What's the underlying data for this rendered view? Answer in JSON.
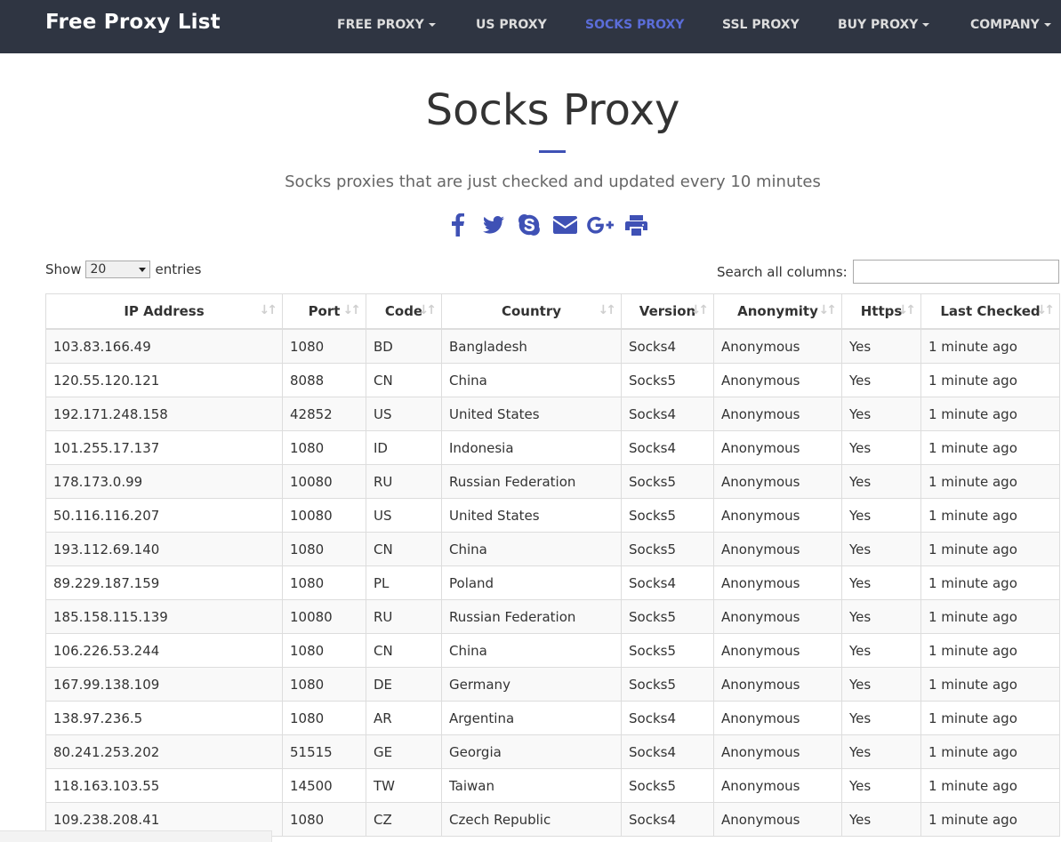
{
  "navbar": {
    "brand": "Free Proxy List",
    "items": [
      {
        "label": "FREE PROXY",
        "caret": true,
        "active": false
      },
      {
        "label": "US PROXY",
        "caret": false,
        "active": false
      },
      {
        "label": "SOCKS PROXY",
        "caret": false,
        "active": true
      },
      {
        "label": "SSL PROXY",
        "caret": false,
        "active": false
      },
      {
        "label": "BUY PROXY",
        "caret": true,
        "active": false
      },
      {
        "label": "COMPANY",
        "caret": true,
        "active": false
      }
    ]
  },
  "header": {
    "title": "Socks Proxy",
    "subtitle": "Socks proxies that are just checked and updated every 10 minutes"
  },
  "share": [
    "facebook-icon",
    "twitter-icon",
    "skype-icon",
    "envelope-icon",
    "google-plus-icon",
    "print-icon"
  ],
  "colors": {
    "nav_bg": "#2f3542",
    "accent": "#3f51b5",
    "active_nav": "#5b6dd9"
  },
  "table_controls": {
    "show_label": "Show",
    "entries_value": "20",
    "entries_label": "entries",
    "search_label": "Search all columns:"
  },
  "table": {
    "columns": [
      "IP Address",
      "Port",
      "Code",
      "Country",
      "Version",
      "Anonymity",
      "Https",
      "Last Checked"
    ],
    "rows": [
      [
        "103.83.166.49",
        "1080",
        "BD",
        "Bangladesh",
        "Socks4",
        "Anonymous",
        "Yes",
        "1 minute ago"
      ],
      [
        "120.55.120.121",
        "8088",
        "CN",
        "China",
        "Socks5",
        "Anonymous",
        "Yes",
        "1 minute ago"
      ],
      [
        "192.171.248.158",
        "42852",
        "US",
        "United States",
        "Socks4",
        "Anonymous",
        "Yes",
        "1 minute ago"
      ],
      [
        "101.255.17.137",
        "1080",
        "ID",
        "Indonesia",
        "Socks4",
        "Anonymous",
        "Yes",
        "1 minute ago"
      ],
      [
        "178.173.0.99",
        "10080",
        "RU",
        "Russian Federation",
        "Socks5",
        "Anonymous",
        "Yes",
        "1 minute ago"
      ],
      [
        "50.116.116.207",
        "10080",
        "US",
        "United States",
        "Socks5",
        "Anonymous",
        "Yes",
        "1 minute ago"
      ],
      [
        "193.112.69.140",
        "1080",
        "CN",
        "China",
        "Socks5",
        "Anonymous",
        "Yes",
        "1 minute ago"
      ],
      [
        "89.229.187.159",
        "1080",
        "PL",
        "Poland",
        "Socks4",
        "Anonymous",
        "Yes",
        "1 minute ago"
      ],
      [
        "185.158.115.139",
        "10080",
        "RU",
        "Russian Federation",
        "Socks5",
        "Anonymous",
        "Yes",
        "1 minute ago"
      ],
      [
        "106.226.53.244",
        "1080",
        "CN",
        "China",
        "Socks5",
        "Anonymous",
        "Yes",
        "1 minute ago"
      ],
      [
        "167.99.138.109",
        "1080",
        "DE",
        "Germany",
        "Socks5",
        "Anonymous",
        "Yes",
        "1 minute ago"
      ],
      [
        "138.97.236.5",
        "1080",
        "AR",
        "Argentina",
        "Socks4",
        "Anonymous",
        "Yes",
        "1 minute ago"
      ],
      [
        "80.241.253.202",
        "51515",
        "GE",
        "Georgia",
        "Socks4",
        "Anonymous",
        "Yes",
        "1 minute ago"
      ],
      [
        "118.163.103.55",
        "14500",
        "TW",
        "Taiwan",
        "Socks5",
        "Anonymous",
        "Yes",
        "1 minute ago"
      ],
      [
        "109.238.208.41",
        "1080",
        "CZ",
        "Czech Republic",
        "Socks4",
        "Anonymous",
        "Yes",
        "1 minute ago"
      ]
    ]
  }
}
